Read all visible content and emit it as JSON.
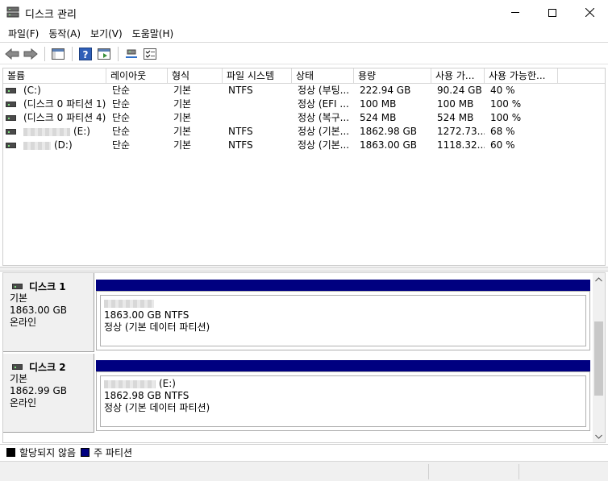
{
  "window": {
    "title": "디스크 관리"
  },
  "menu": [
    "파일(F)",
    "동작(A)",
    "보기(V)",
    "도움말(H)"
  ],
  "toolbar": [
    "back-icon",
    "forward-icon",
    "console-tree-icon",
    "help-icon",
    "action-pane-icon",
    "connect-icon",
    "properties-icon"
  ],
  "list": {
    "columns": [
      "볼륨",
      "레이아웃",
      "형식",
      "파일 시스템",
      "상태",
      "용량",
      "사용 가...",
      "사용 가능한..."
    ],
    "rows": [
      {
        "volume": "(C:)",
        "layout": "단순",
        "type": "기본",
        "fs": "NTFS",
        "status": "정상 (부팅...",
        "capacity": "222.94 GB",
        "free": "90.24 GB",
        "pct": "40 %"
      },
      {
        "volume": "(디스크 0 파티션 1)",
        "layout": "단순",
        "type": "기본",
        "fs": "",
        "status": "정상 (EFI ...",
        "capacity": "100 MB",
        "free": "100 MB",
        "pct": "100 %"
      },
      {
        "volume": "(디스크 0 파티션 4)",
        "layout": "단순",
        "type": "기본",
        "fs": "",
        "status": "정상 (복구...",
        "capacity": "524 MB",
        "free": "524 MB",
        "pct": "100 %"
      },
      {
        "volume": "(E:)",
        "layout": "단순",
        "type": "기본",
        "fs": "NTFS",
        "status": "정상 (기본...",
        "capacity": "1862.98 GB",
        "free": "1272.73...",
        "pct": "68 %"
      },
      {
        "volume": "(D:)",
        "layout": "단순",
        "type": "기본",
        "fs": "NTFS",
        "status": "정상 (기본...",
        "capacity": "1863.00 GB",
        "free": "1118.32...",
        "pct": "60 %"
      }
    ]
  },
  "disks": [
    {
      "name": "디스크 1",
      "type": "기본",
      "size": "1863.00 GB",
      "state": "온라인",
      "partition": {
        "label": "",
        "size_fs": "1863.00 GB NTFS",
        "status": "정상 (기본 데이터 파티션)"
      }
    },
    {
      "name": "디스크 2",
      "type": "기본",
      "size": "1862.99 GB",
      "state": "온라인",
      "partition": {
        "label": "(E:)",
        "size_fs": "1862.98 GB NTFS",
        "status": "정상 (기본 데이터 파티션)"
      }
    }
  ],
  "legend": [
    {
      "label": "할당되지 않음",
      "color": "#000000"
    },
    {
      "label": "주 파티션",
      "color": "#000080"
    }
  ]
}
